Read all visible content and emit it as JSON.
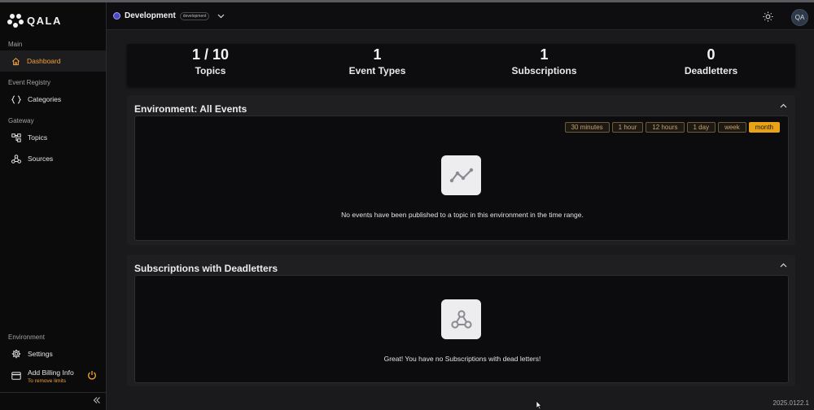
{
  "app": {
    "logo_text": "QALA"
  },
  "sidebar": {
    "sections": [
      {
        "label": "Main"
      },
      {
        "label": "Event Registry"
      },
      {
        "label": "Gateway"
      },
      {
        "label": "Environment"
      }
    ],
    "items": [
      {
        "label": "Dashboard",
        "icon": "home-icon",
        "active": true
      },
      {
        "label": "Categories",
        "icon": "braces-icon"
      },
      {
        "label": "Topics",
        "icon": "topics-icon"
      },
      {
        "label": "Sources",
        "icon": "sources-icon"
      },
      {
        "label": "Settings",
        "icon": "gear-icon"
      }
    ],
    "billing": {
      "label": "Add Billing Info",
      "sub": "To remove limits",
      "icon": "credit-card-icon"
    }
  },
  "header": {
    "environment": "Development",
    "environment_badge": "development",
    "avatar_initials": "QA"
  },
  "stats": [
    {
      "value": "1 / 10",
      "label": "Topics"
    },
    {
      "value": "1",
      "label": "Event Types"
    },
    {
      "value": "1",
      "label": "Subscriptions"
    },
    {
      "value": "0",
      "label": "Deadletters"
    }
  ],
  "events_panel": {
    "title": "Environment: All Events",
    "ranges": [
      "30 minutes",
      "1 hour",
      "12 hours",
      "1 day",
      "week",
      "month"
    ],
    "active_range": "month",
    "empty_message": "No events have been published to a topic in this environment in the time range."
  },
  "deadletters_panel": {
    "title": "Subscriptions with Deadletters",
    "empty_message": "Great! You have no Subscriptions with dead letters!"
  },
  "version": "2025.0122.1",
  "colors": {
    "accent": "#f2a23a",
    "active_range": "#e8a317",
    "background": "#1a1a1c"
  }
}
